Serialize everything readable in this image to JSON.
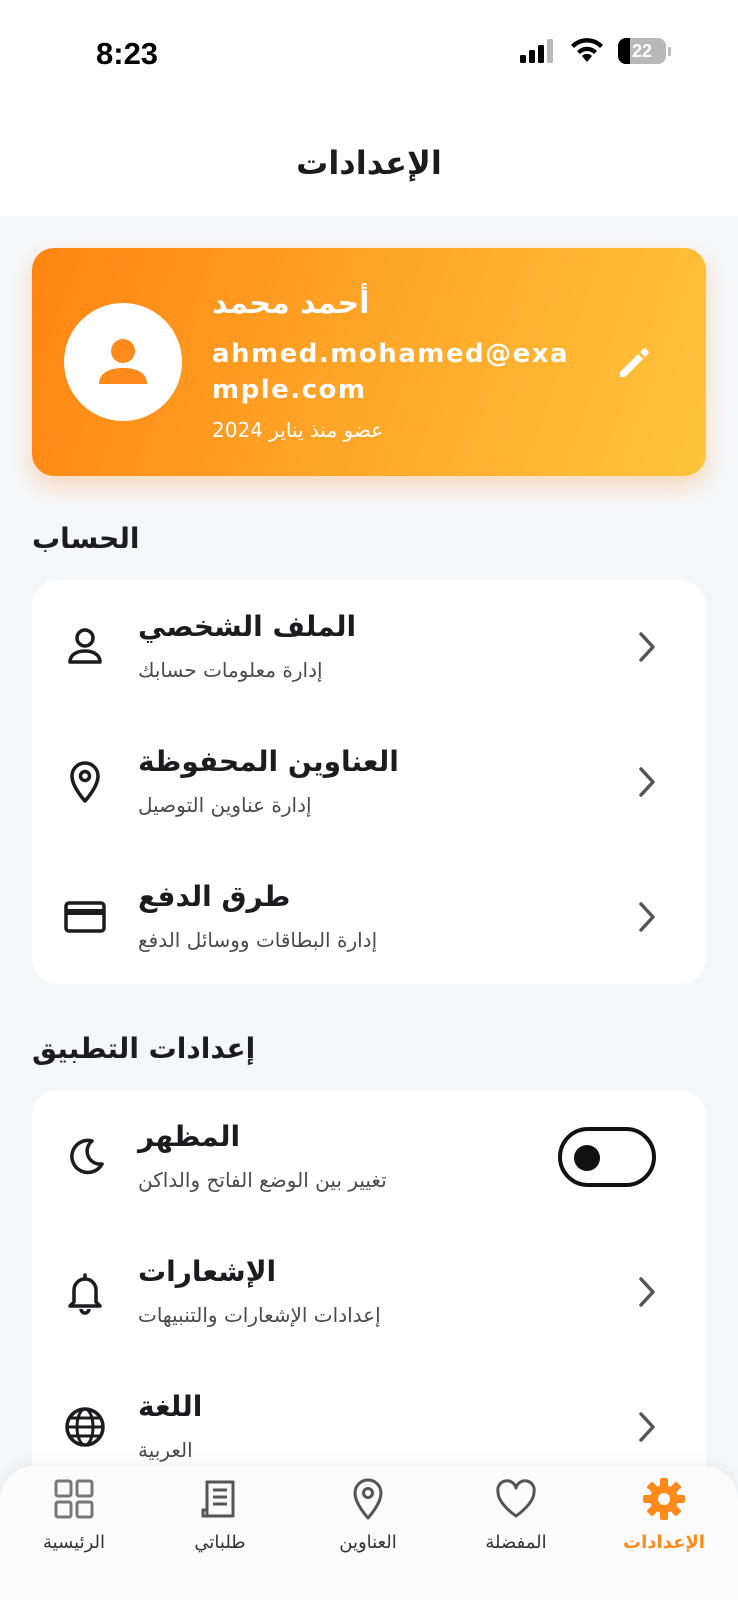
{
  "status_bar": {
    "time": "8:23",
    "battery": "22"
  },
  "header": {
    "title": "الإعدادات"
  },
  "profile": {
    "name": "أحمد محمد",
    "email": "ahmed.mohamed@example.com",
    "member_since": "عضو منذ يناير 2024"
  },
  "sections": {
    "account": {
      "title": "الحساب",
      "items": [
        {
          "title": "الملف الشخصي",
          "subtitle": "إدارة معلومات حسابك",
          "icon": "person-outline-icon"
        },
        {
          "title": "العناوين المحفوظة",
          "subtitle": "إدارة عناوين التوصيل",
          "icon": "location-pin-icon"
        },
        {
          "title": "طرق الدفع",
          "subtitle": "إدارة البطاقات ووسائل الدفع",
          "icon": "credit-card-icon"
        }
      ]
    },
    "app": {
      "title": "إعدادات التطبيق",
      "items": [
        {
          "title": "المظهر",
          "subtitle": "تغيير بين الوضع الفاتح والداكن",
          "icon": "moon-icon",
          "toggle": false
        },
        {
          "title": "الإشعارات",
          "subtitle": "إعدادات الإشعارات والتنبيهات",
          "icon": "bell-icon"
        },
        {
          "title": "اللغة",
          "subtitle": "العربية",
          "icon": "globe-icon"
        }
      ]
    }
  },
  "tab_bar": {
    "tabs": [
      {
        "label": "الإعدادات",
        "icon": "gear-icon",
        "active": true
      },
      {
        "label": "المفضلة",
        "icon": "heart-icon",
        "active": false
      },
      {
        "label": "العناوين",
        "icon": "location-pin-icon",
        "active": false
      },
      {
        "label": "طلباتي",
        "icon": "receipt-icon",
        "active": false
      },
      {
        "label": "الرئيسية",
        "icon": "grid-icon",
        "active": false
      }
    ]
  },
  "colors": {
    "accent": "#ff8a1c",
    "gradient_start": "#ff8412",
    "gradient_end": "#ffc43c",
    "background": "#f5f6f8"
  }
}
